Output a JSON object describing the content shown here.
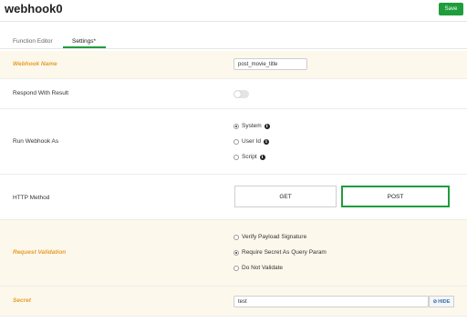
{
  "header": {
    "title": "webhook0",
    "save_label": "Save"
  },
  "tabs": [
    {
      "label": "Function Editor"
    },
    {
      "label": "Settings*"
    }
  ],
  "webhook_name": {
    "label": "Webhook Name",
    "value": "post_movie_title"
  },
  "respond": {
    "label": "Respond With Result",
    "enabled": false
  },
  "run_as": {
    "label": "Run Webhook As",
    "options": [
      {
        "label": "System",
        "selected": true,
        "icon": "info-icon"
      },
      {
        "label": "User Id",
        "selected": false,
        "icon": "info-icon"
      },
      {
        "label": "Script",
        "selected": false,
        "icon": "info-icon"
      }
    ]
  },
  "http_method": {
    "label": "HTTP Method",
    "options": [
      "GET",
      "POST"
    ],
    "selected": "POST"
  },
  "validation": {
    "label": "Request Validation",
    "options": [
      {
        "label": "Verify Payload Signature",
        "selected": false
      },
      {
        "label": "Require Secret As Query Param",
        "selected": true
      },
      {
        "label": "Do Not Validate",
        "selected": false
      }
    ]
  },
  "secret": {
    "label": "Secret",
    "value": "test",
    "hide_label": "HIDE"
  },
  "colors": {
    "accent": "#1f9d3d",
    "required": "#e59d2c",
    "highlight_row": "#fdf8ec"
  }
}
